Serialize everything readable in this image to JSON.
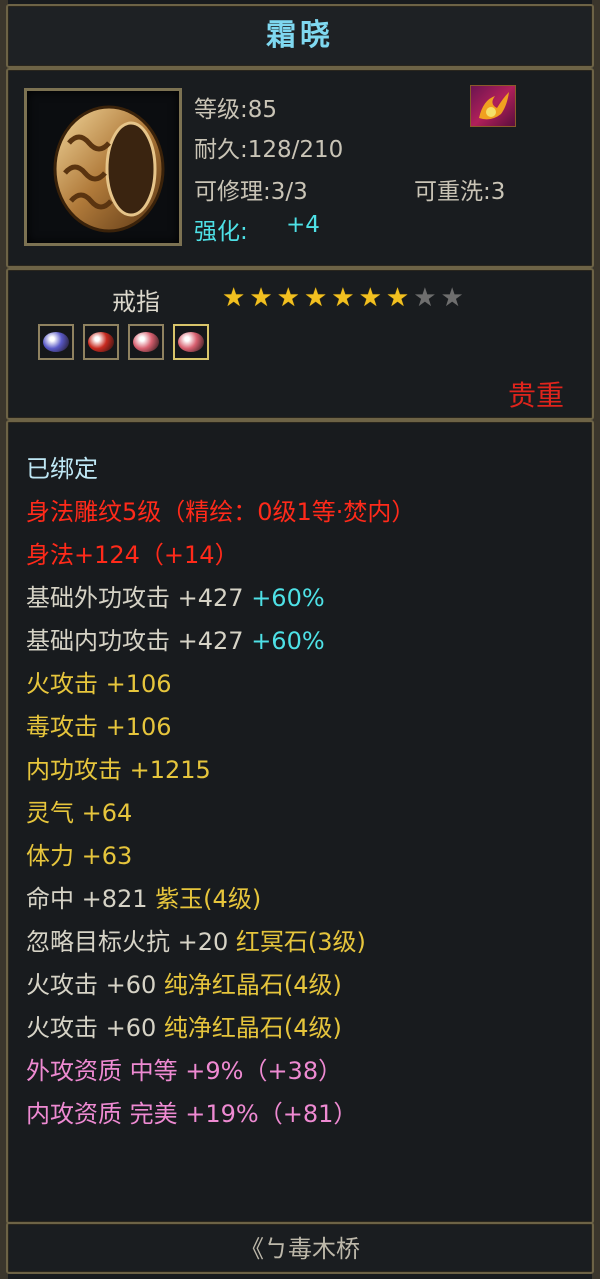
{
  "title": "霜晓",
  "header": {
    "level": "等级:85",
    "durability": "耐久:128/210",
    "repair": "可修理:3/3",
    "rewash": "可重洗:3",
    "enhance_label": "强化:",
    "enhance_value": "+4"
  },
  "item_type": "戒指",
  "stars": {
    "filled": 7,
    "total": 9
  },
  "rarity": "贵重",
  "owner": "《ㄅ毒木桥",
  "colors": {
    "white": "#d6d3c6",
    "red": "#ff2a1a",
    "gold": "#e6c53c",
    "cyan": "#4ee1e6",
    "pink": "#ee8ad2",
    "cream": "#c8c2b1"
  },
  "gems": [
    {
      "name": "blue-gem-icon",
      "color": "#5a5ac8"
    },
    {
      "name": "red-gem-icon",
      "color": "#c82a20"
    },
    {
      "name": "pink-gem-icon",
      "color": "#d86070"
    },
    {
      "name": "pink-gem-icon",
      "color": "#d86070"
    }
  ],
  "attributes": [
    [
      {
        "t": "已绑定",
        "c": "#bfe8f5"
      }
    ],
    [
      {
        "t": "身法雕纹5级（精绘：0级1等·焚内）",
        "c": "#ff2a1a"
      }
    ],
    [
      {
        "t": "身法+124（+14）",
        "c": "#ff2a1a"
      }
    ],
    [
      {
        "t": "基础外功攻击 +427 ",
        "c": "#d6d3c6"
      },
      {
        "t": "+60%",
        "c": "#4ee1e6"
      }
    ],
    [
      {
        "t": "基础内功攻击 +427 ",
        "c": "#d6d3c6"
      },
      {
        "t": "+60%",
        "c": "#4ee1e6"
      }
    ],
    [
      {
        "t": "火攻击 +106",
        "c": "#e6c53c"
      }
    ],
    [
      {
        "t": "毒攻击 +106",
        "c": "#e6c53c"
      }
    ],
    [
      {
        "t": "内功攻击 +1215",
        "c": "#e6c53c"
      }
    ],
    [
      {
        "t": "灵气 +64",
        "c": "#e6c53c"
      }
    ],
    [
      {
        "t": "体力 +63",
        "c": "#e6c53c"
      }
    ],
    [
      {
        "t": "命中 +821 ",
        "c": "#d6d3c6"
      },
      {
        "t": "紫玉(4级)",
        "c": "#e6c53c"
      }
    ],
    [
      {
        "t": "忽略目标火抗 +20 ",
        "c": "#d6d3c6"
      },
      {
        "t": "红冥石(3级)",
        "c": "#e6c53c"
      }
    ],
    [
      {
        "t": "火攻击 +60 ",
        "c": "#d6d3c6"
      },
      {
        "t": "纯净红晶石(4级)",
        "c": "#e6c53c"
      }
    ],
    [
      {
        "t": "火攻击 +60 ",
        "c": "#d6d3c6"
      },
      {
        "t": "纯净红晶石(4级)",
        "c": "#e6c53c"
      }
    ],
    [
      {
        "t": "外攻资质  中等 +9%（+38）",
        "c": "#ee8ad2"
      }
    ],
    [
      {
        "t": "内攻资质  完美 +19%（+81）",
        "c": "#ee8ad2"
      }
    ]
  ]
}
